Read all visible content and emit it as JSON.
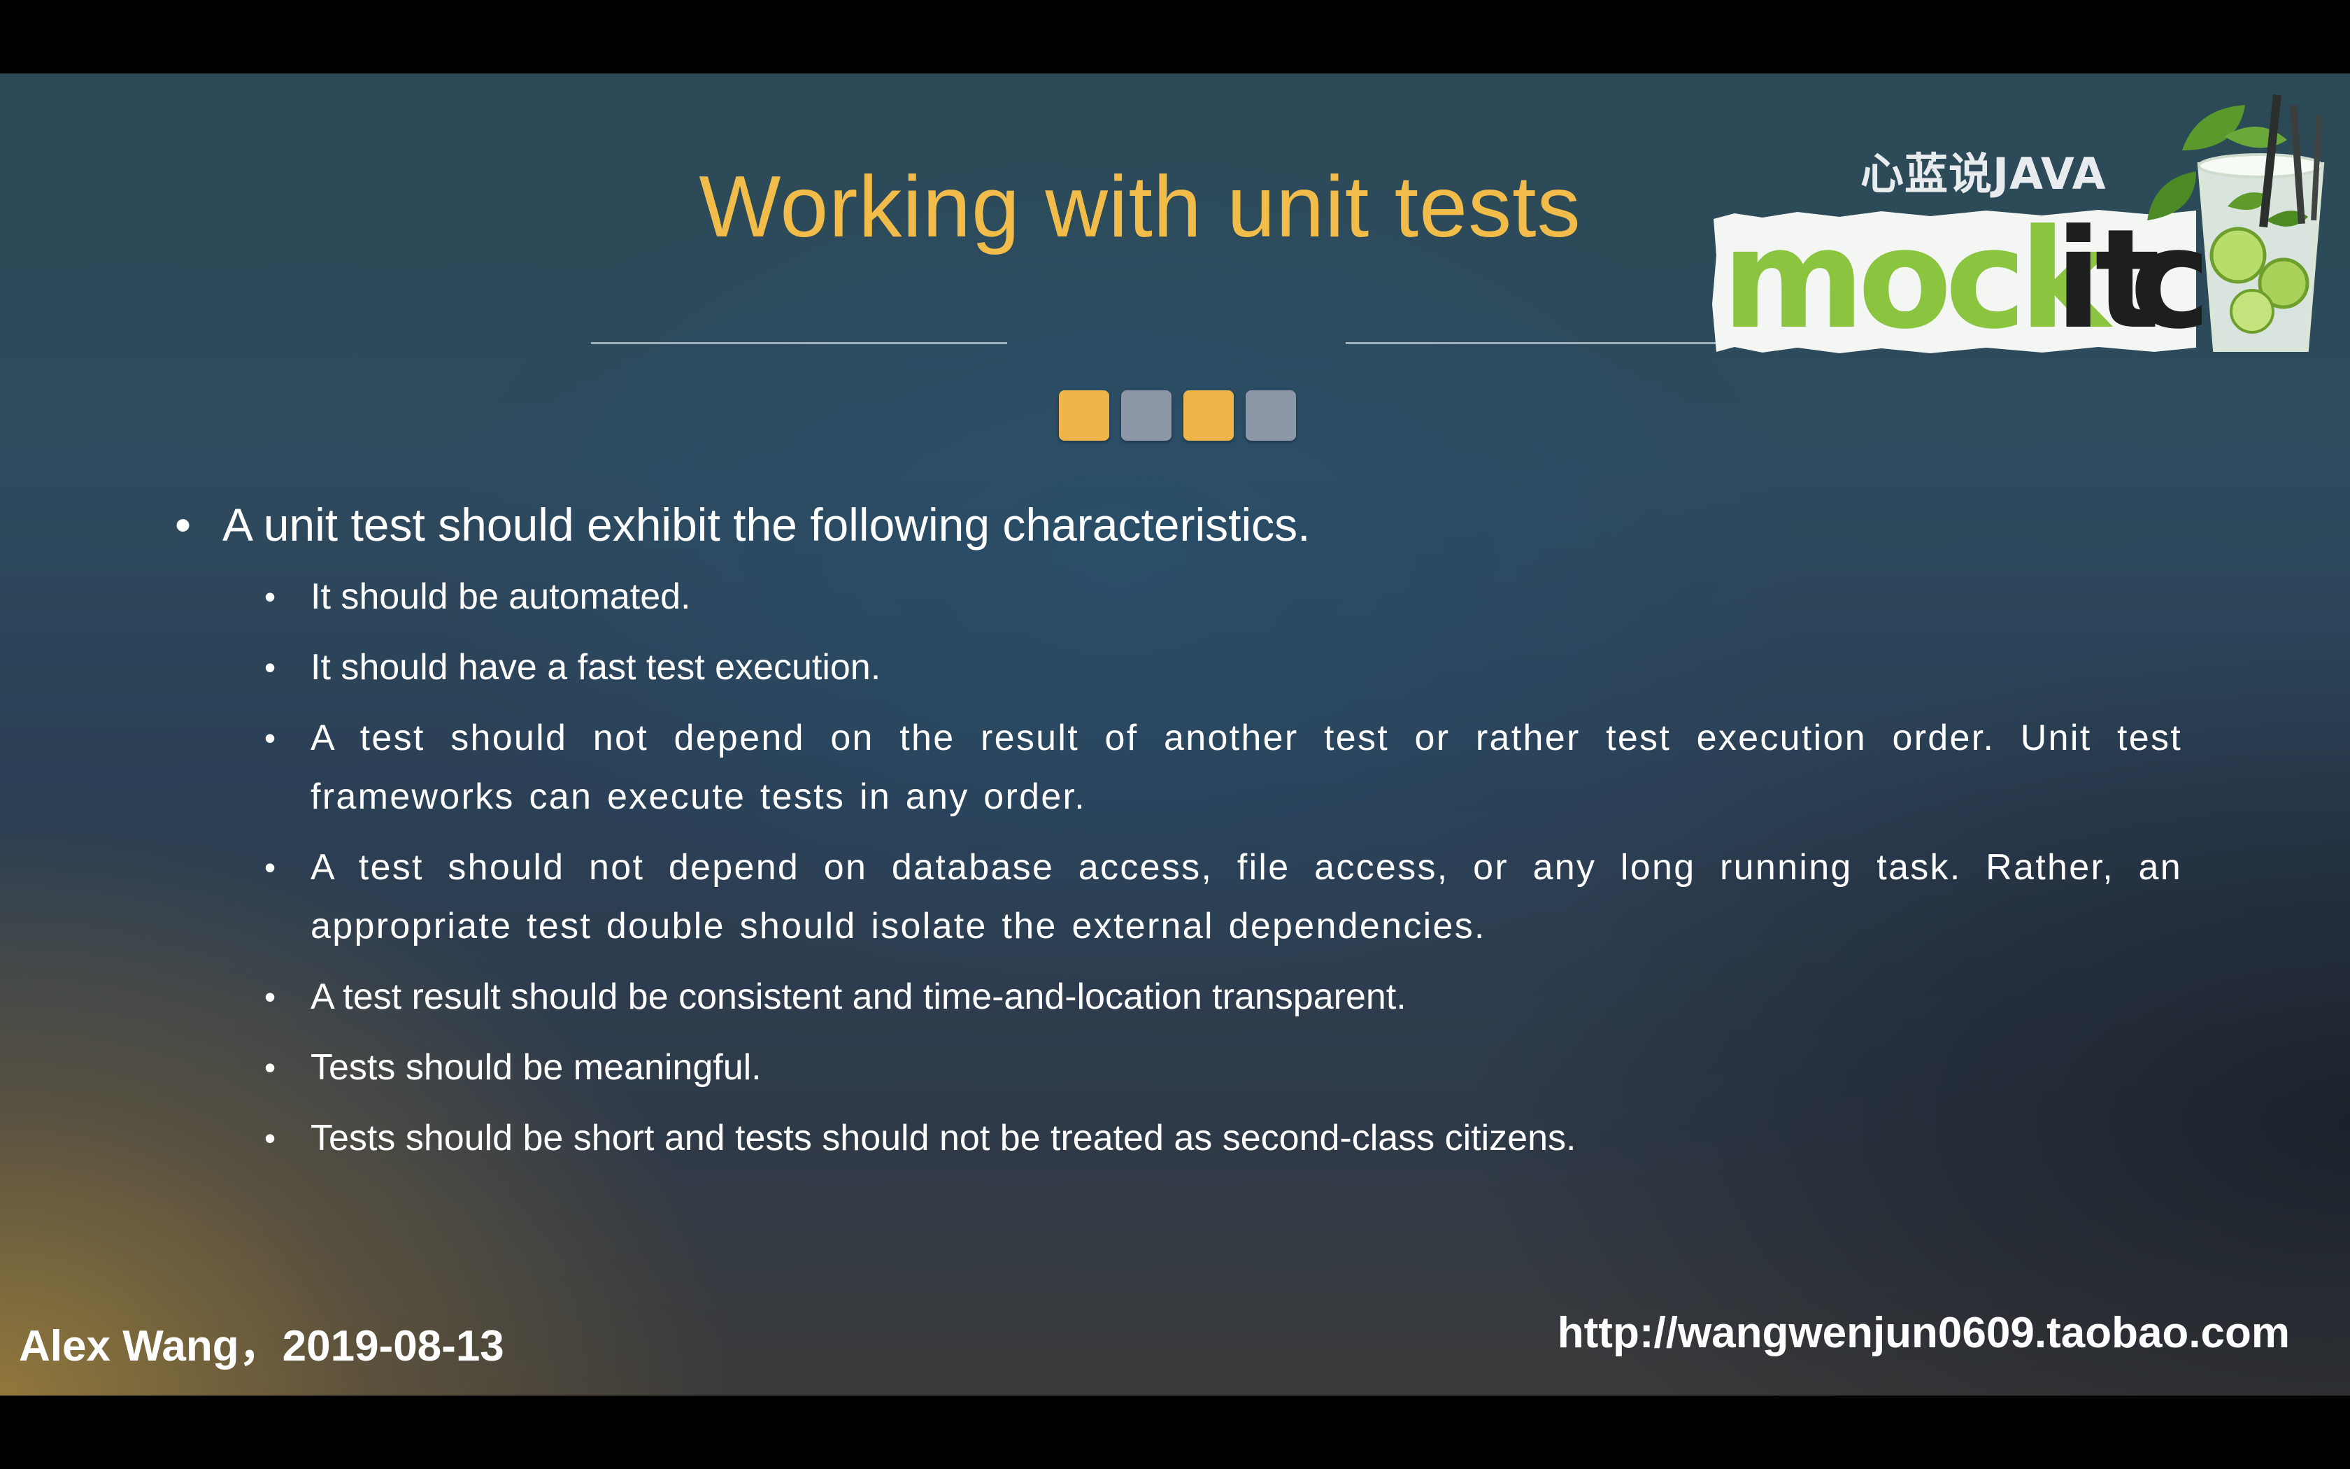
{
  "slide": {
    "title": "Working with unit tests",
    "logo": {
      "caption": "心蓝说JAVA",
      "wordmark": "mockito"
    },
    "decor_squares": [
      "gold",
      "grey",
      "gold",
      "grey"
    ],
    "colors": {
      "title": "#f1bc4a",
      "square_gold": "#f0b54a",
      "square_grey": "#8c98a8",
      "logo_green": "#8bc43f"
    },
    "main_bullet": "A unit test should exhibit the following characteristics.",
    "sub_bullets": [
      "It should be automated.",
      "It should have a fast test execution.",
      "A test should not depend on the result of another test or rather test execution order. Unit test frameworks can execute tests in any order.",
      "A test should not depend on database access, file access, or any long running task. Rather, an appropriate test double should isolate the external dependencies.",
      "A test result should be consistent and time-and-location transparent.",
      "Tests should be meaningful.",
      "Tests should be short and tests should not be treated as second-class citizens."
    ],
    "bullet_glyph": "•",
    "footer": {
      "author_date": "Alex Wang，2019-08-13",
      "url": "http://wangwenjun0609.taobao.com"
    }
  }
}
